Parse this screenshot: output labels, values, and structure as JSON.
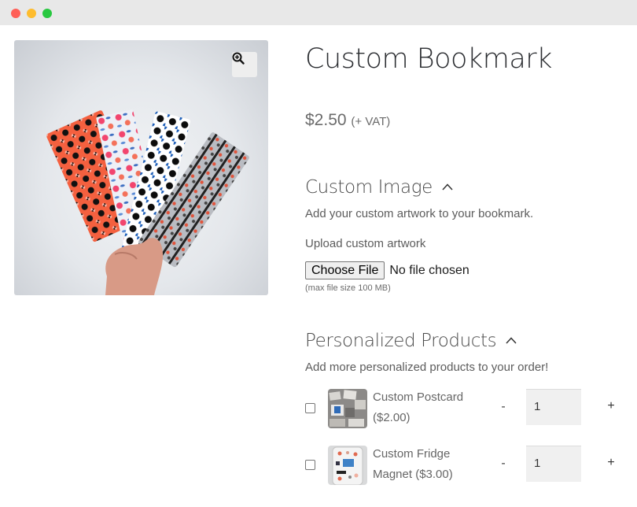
{
  "window": {
    "controls": [
      "close",
      "minimize",
      "maximize"
    ]
  },
  "gallery": {
    "image_alt": "Hand holding four patterned bookmarks",
    "zoom_icon": "magnifier-plus-icon"
  },
  "product": {
    "title": "Custom Bookmark",
    "price": "$2.50",
    "price_suffix": "(+ VAT)"
  },
  "custom_image": {
    "heading": "Custom Image",
    "toggle_icon": "chevron-up-icon",
    "description": "Add your custom artwork to your bookmark.",
    "upload_label": "Upload custom artwork",
    "choose_file_label": "Choose File",
    "file_status": "No file chosen",
    "max_size_note": "(max file size 100 MB)"
  },
  "personalized_products": {
    "heading": "Personalized Products",
    "toggle_icon": "chevron-up-icon",
    "description": "Add more personalized products to your order!",
    "items": [
      {
        "name": "Custom Postcard",
        "price": "($2.00)",
        "checked": false,
        "quantity": "1",
        "minus": "-",
        "plus": "+"
      },
      {
        "name": "Custom Fridge",
        "name2": "Magnet ($3.00)",
        "checked": false,
        "quantity": "1",
        "minus": "-",
        "plus": "+"
      }
    ]
  }
}
